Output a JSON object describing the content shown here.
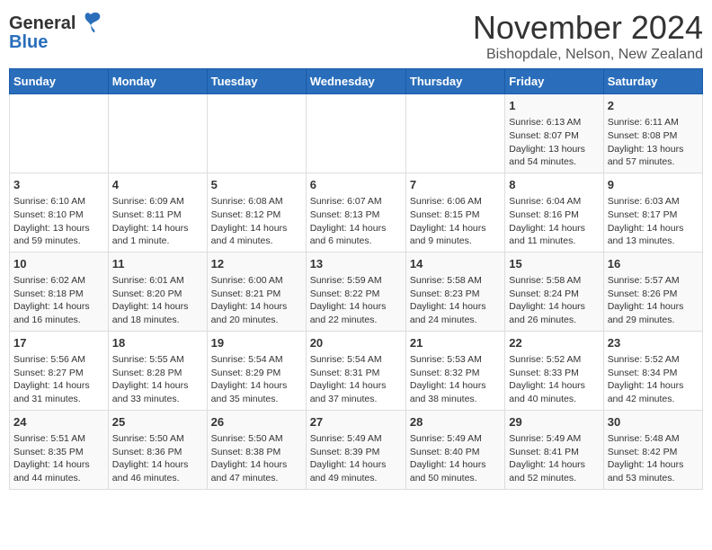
{
  "header": {
    "logo_line1": "General",
    "logo_line2": "Blue",
    "month_year": "November 2024",
    "location": "Bishopdale, Nelson, New Zealand"
  },
  "days_of_week": [
    "Sunday",
    "Monday",
    "Tuesday",
    "Wednesday",
    "Thursday",
    "Friday",
    "Saturday"
  ],
  "weeks": [
    [
      {
        "day": "",
        "sunrise": "",
        "sunset": "",
        "daylight": "",
        "empty": true
      },
      {
        "day": "",
        "sunrise": "",
        "sunset": "",
        "daylight": "",
        "empty": true
      },
      {
        "day": "",
        "sunrise": "",
        "sunset": "",
        "daylight": "",
        "empty": true
      },
      {
        "day": "",
        "sunrise": "",
        "sunset": "",
        "daylight": "",
        "empty": true
      },
      {
        "day": "",
        "sunrise": "",
        "sunset": "",
        "daylight": "",
        "empty": true
      },
      {
        "day": "1",
        "sunrise": "Sunrise: 6:13 AM",
        "sunset": "Sunset: 8:07 PM",
        "daylight": "Daylight: 13 hours and 54 minutes.",
        "empty": false
      },
      {
        "day": "2",
        "sunrise": "Sunrise: 6:11 AM",
        "sunset": "Sunset: 8:08 PM",
        "daylight": "Daylight: 13 hours and 57 minutes.",
        "empty": false
      }
    ],
    [
      {
        "day": "3",
        "sunrise": "Sunrise: 6:10 AM",
        "sunset": "Sunset: 8:10 PM",
        "daylight": "Daylight: 13 hours and 59 minutes.",
        "empty": false
      },
      {
        "day": "4",
        "sunrise": "Sunrise: 6:09 AM",
        "sunset": "Sunset: 8:11 PM",
        "daylight": "Daylight: 14 hours and 1 minute.",
        "empty": false
      },
      {
        "day": "5",
        "sunrise": "Sunrise: 6:08 AM",
        "sunset": "Sunset: 8:12 PM",
        "daylight": "Daylight: 14 hours and 4 minutes.",
        "empty": false
      },
      {
        "day": "6",
        "sunrise": "Sunrise: 6:07 AM",
        "sunset": "Sunset: 8:13 PM",
        "daylight": "Daylight: 14 hours and 6 minutes.",
        "empty": false
      },
      {
        "day": "7",
        "sunrise": "Sunrise: 6:06 AM",
        "sunset": "Sunset: 8:15 PM",
        "daylight": "Daylight: 14 hours and 9 minutes.",
        "empty": false
      },
      {
        "day": "8",
        "sunrise": "Sunrise: 6:04 AM",
        "sunset": "Sunset: 8:16 PM",
        "daylight": "Daylight: 14 hours and 11 minutes.",
        "empty": false
      },
      {
        "day": "9",
        "sunrise": "Sunrise: 6:03 AM",
        "sunset": "Sunset: 8:17 PM",
        "daylight": "Daylight: 14 hours and 13 minutes.",
        "empty": false
      }
    ],
    [
      {
        "day": "10",
        "sunrise": "Sunrise: 6:02 AM",
        "sunset": "Sunset: 8:18 PM",
        "daylight": "Daylight: 14 hours and 16 minutes.",
        "empty": false
      },
      {
        "day": "11",
        "sunrise": "Sunrise: 6:01 AM",
        "sunset": "Sunset: 8:20 PM",
        "daylight": "Daylight: 14 hours and 18 minutes.",
        "empty": false
      },
      {
        "day": "12",
        "sunrise": "Sunrise: 6:00 AM",
        "sunset": "Sunset: 8:21 PM",
        "daylight": "Daylight: 14 hours and 20 minutes.",
        "empty": false
      },
      {
        "day": "13",
        "sunrise": "Sunrise: 5:59 AM",
        "sunset": "Sunset: 8:22 PM",
        "daylight": "Daylight: 14 hours and 22 minutes.",
        "empty": false
      },
      {
        "day": "14",
        "sunrise": "Sunrise: 5:58 AM",
        "sunset": "Sunset: 8:23 PM",
        "daylight": "Daylight: 14 hours and 24 minutes.",
        "empty": false
      },
      {
        "day": "15",
        "sunrise": "Sunrise: 5:58 AM",
        "sunset": "Sunset: 8:24 PM",
        "daylight": "Daylight: 14 hours and 26 minutes.",
        "empty": false
      },
      {
        "day": "16",
        "sunrise": "Sunrise: 5:57 AM",
        "sunset": "Sunset: 8:26 PM",
        "daylight": "Daylight: 14 hours and 29 minutes.",
        "empty": false
      }
    ],
    [
      {
        "day": "17",
        "sunrise": "Sunrise: 5:56 AM",
        "sunset": "Sunset: 8:27 PM",
        "daylight": "Daylight: 14 hours and 31 minutes.",
        "empty": false
      },
      {
        "day": "18",
        "sunrise": "Sunrise: 5:55 AM",
        "sunset": "Sunset: 8:28 PM",
        "daylight": "Daylight: 14 hours and 33 minutes.",
        "empty": false
      },
      {
        "day": "19",
        "sunrise": "Sunrise: 5:54 AM",
        "sunset": "Sunset: 8:29 PM",
        "daylight": "Daylight: 14 hours and 35 minutes.",
        "empty": false
      },
      {
        "day": "20",
        "sunrise": "Sunrise: 5:54 AM",
        "sunset": "Sunset: 8:31 PM",
        "daylight": "Daylight: 14 hours and 37 minutes.",
        "empty": false
      },
      {
        "day": "21",
        "sunrise": "Sunrise: 5:53 AM",
        "sunset": "Sunset: 8:32 PM",
        "daylight": "Daylight: 14 hours and 38 minutes.",
        "empty": false
      },
      {
        "day": "22",
        "sunrise": "Sunrise: 5:52 AM",
        "sunset": "Sunset: 8:33 PM",
        "daylight": "Daylight: 14 hours and 40 minutes.",
        "empty": false
      },
      {
        "day": "23",
        "sunrise": "Sunrise: 5:52 AM",
        "sunset": "Sunset: 8:34 PM",
        "daylight": "Daylight: 14 hours and 42 minutes.",
        "empty": false
      }
    ],
    [
      {
        "day": "24",
        "sunrise": "Sunrise: 5:51 AM",
        "sunset": "Sunset: 8:35 PM",
        "daylight": "Daylight: 14 hours and 44 minutes.",
        "empty": false
      },
      {
        "day": "25",
        "sunrise": "Sunrise: 5:50 AM",
        "sunset": "Sunset: 8:36 PM",
        "daylight": "Daylight: 14 hours and 46 minutes.",
        "empty": false
      },
      {
        "day": "26",
        "sunrise": "Sunrise: 5:50 AM",
        "sunset": "Sunset: 8:38 PM",
        "daylight": "Daylight: 14 hours and 47 minutes.",
        "empty": false
      },
      {
        "day": "27",
        "sunrise": "Sunrise: 5:49 AM",
        "sunset": "Sunset: 8:39 PM",
        "daylight": "Daylight: 14 hours and 49 minutes.",
        "empty": false
      },
      {
        "day": "28",
        "sunrise": "Sunrise: 5:49 AM",
        "sunset": "Sunset: 8:40 PM",
        "daylight": "Daylight: 14 hours and 50 minutes.",
        "empty": false
      },
      {
        "day": "29",
        "sunrise": "Sunrise: 5:49 AM",
        "sunset": "Sunset: 8:41 PM",
        "daylight": "Daylight: 14 hours and 52 minutes.",
        "empty": false
      },
      {
        "day": "30",
        "sunrise": "Sunrise: 5:48 AM",
        "sunset": "Sunset: 8:42 PM",
        "daylight": "Daylight: 14 hours and 53 minutes.",
        "empty": false
      }
    ]
  ]
}
